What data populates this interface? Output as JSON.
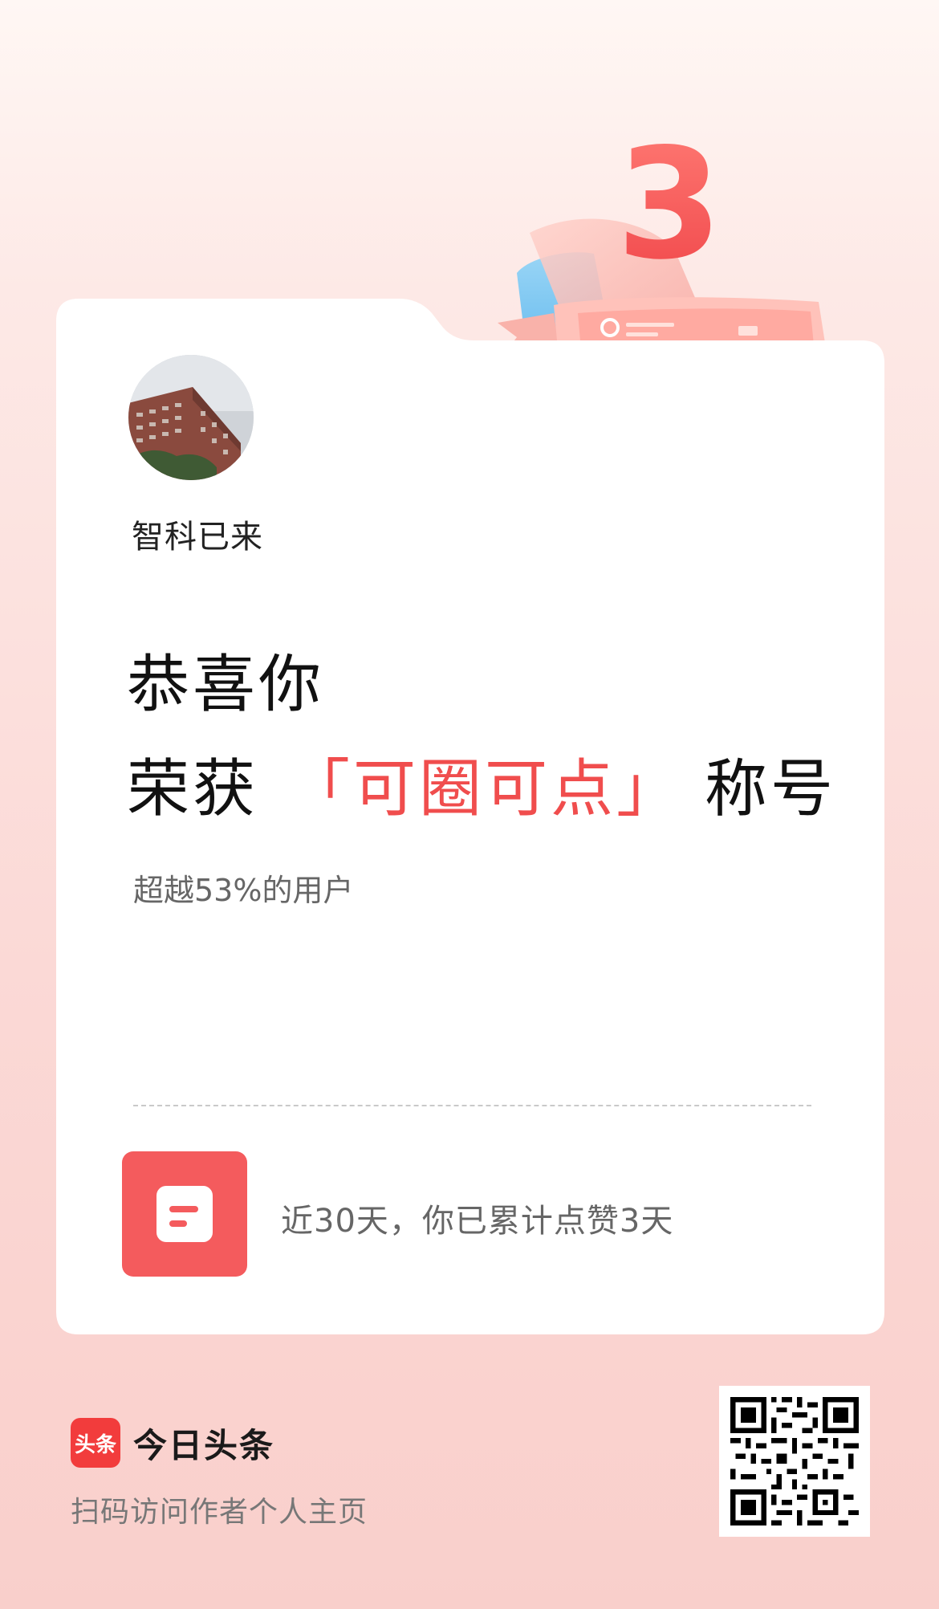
{
  "badge": {
    "level_number": "3"
  },
  "profile": {
    "username": "智科已来"
  },
  "headline": {
    "line1": "恭喜你",
    "line2_prefix": "荣获",
    "honor_title": "「可圈可点」",
    "line2_suffix": "称号"
  },
  "rank_text": "超越53%的用户",
  "stat": {
    "text": "近30天，你已累计点赞3天"
  },
  "footer": {
    "app_logo_text": "头条",
    "app_name": "今日头条",
    "scan_prompt": "扫码访问作者个人主页"
  },
  "colors": {
    "accent": "#f04d4d",
    "icon_bg": "#f45b5d",
    "brand_red": "#f23c3c",
    "card_bg": "#ffffff"
  },
  "icons": {
    "badge": "ribbon-badge-icon",
    "stat": "document-icon",
    "qr": "qr-code"
  }
}
